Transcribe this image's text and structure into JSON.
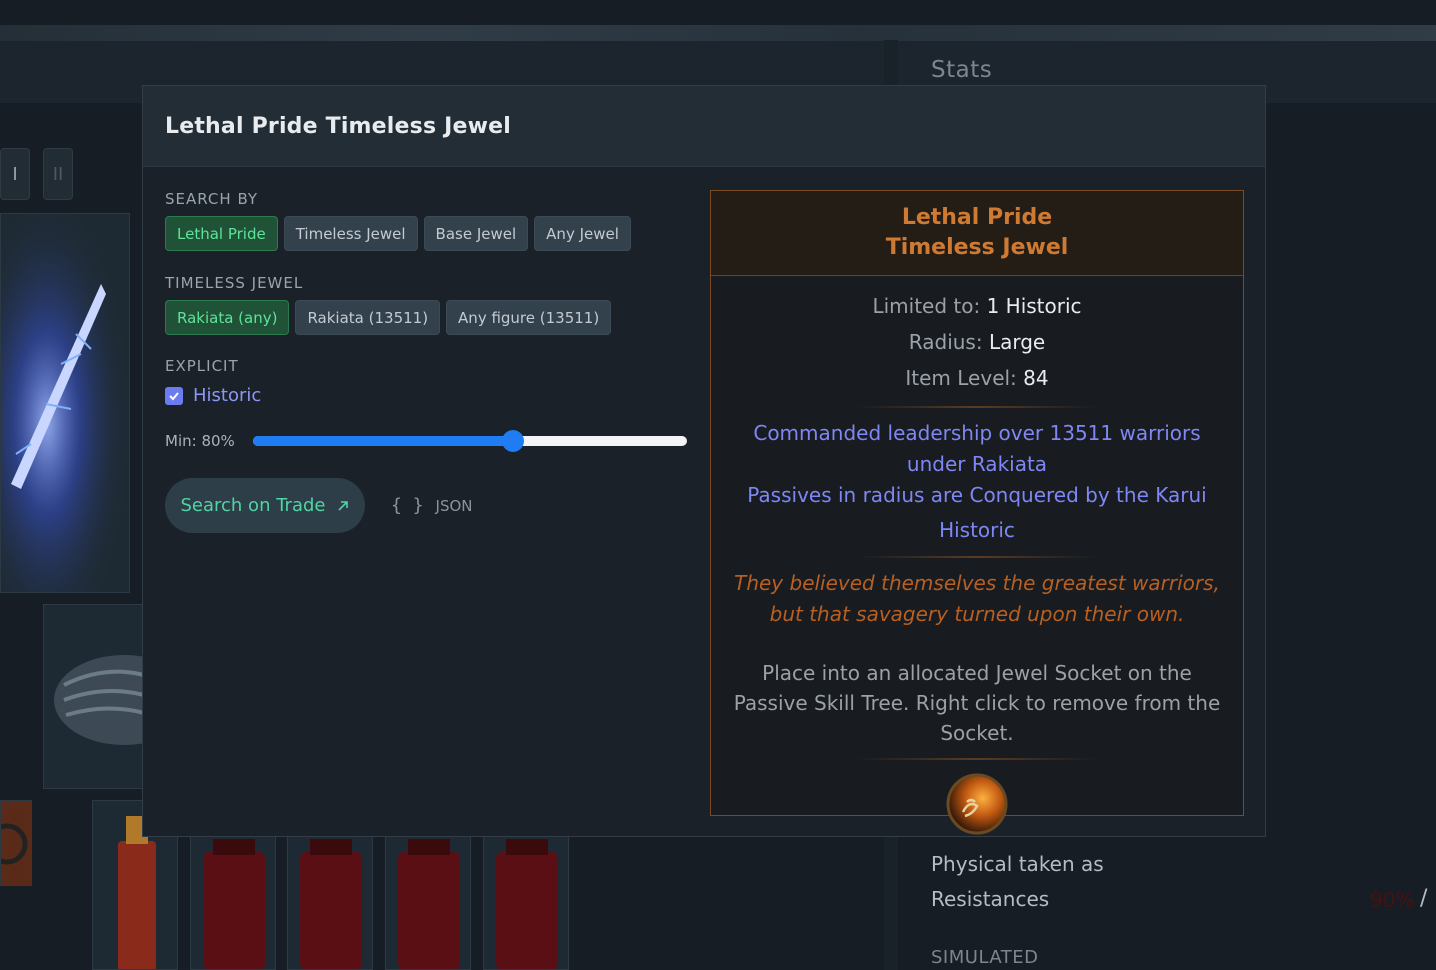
{
  "background": {
    "stats_title": "Stats",
    "tab_buttons": [
      "I",
      "II"
    ],
    "lines": [
      "Physical taken as",
      "Resistances"
    ],
    "simulated_label": "SIMULATED",
    "red_value": "90%",
    "slash": "/"
  },
  "modal": {
    "title": "Lethal Pride Timeless Jewel",
    "search_by": {
      "label": "SEARCH BY",
      "options": [
        "Lethal Pride",
        "Timeless Jewel",
        "Base Jewel",
        "Any Jewel"
      ],
      "selected": "Lethal Pride"
    },
    "timeless_jewel": {
      "label": "TIMELESS JEWEL",
      "options": [
        "Rakiata (any)",
        "Rakiata (13511)",
        "Any figure (13511)"
      ],
      "selected": "Rakiata (any)"
    },
    "explicit": {
      "label": "EXPLICIT",
      "checkbox_label": "Historic",
      "checked": true
    },
    "slider": {
      "label": "Min: 80%",
      "value_fraction": 0.6
    },
    "search_button": "Search on Trade",
    "search_button_icon": "external-arrow-icon",
    "json_braces": "{ }",
    "json_label": "JSON",
    "colors": {
      "accent_green": "#4fd5a4",
      "slider_blue": "#1f7cf2",
      "unique_orange": "#cf7a32",
      "magic_blue": "#7f86f5"
    }
  },
  "item": {
    "name_line1": "Lethal Pride",
    "name_line2": "Timeless Jewel",
    "props": [
      {
        "label": "Limited to: ",
        "value": "1 Historic"
      },
      {
        "label": "Radius: ",
        "value": "Large"
      },
      {
        "label": "Item Level: ",
        "value": "84"
      }
    ],
    "mods": [
      "Commanded leadership over 13511 warriors under Rakiata",
      "Passives in radius are Conquered by the Karui",
      "Historic"
    ],
    "flavour": "They believed themselves the greatest warriors, but that savagery turned upon their own.",
    "description": "Place into an allocated Jewel Socket on the Passive Skill Tree. Right click to remove from the Socket.",
    "icon": "timeless-jewel-icon"
  }
}
